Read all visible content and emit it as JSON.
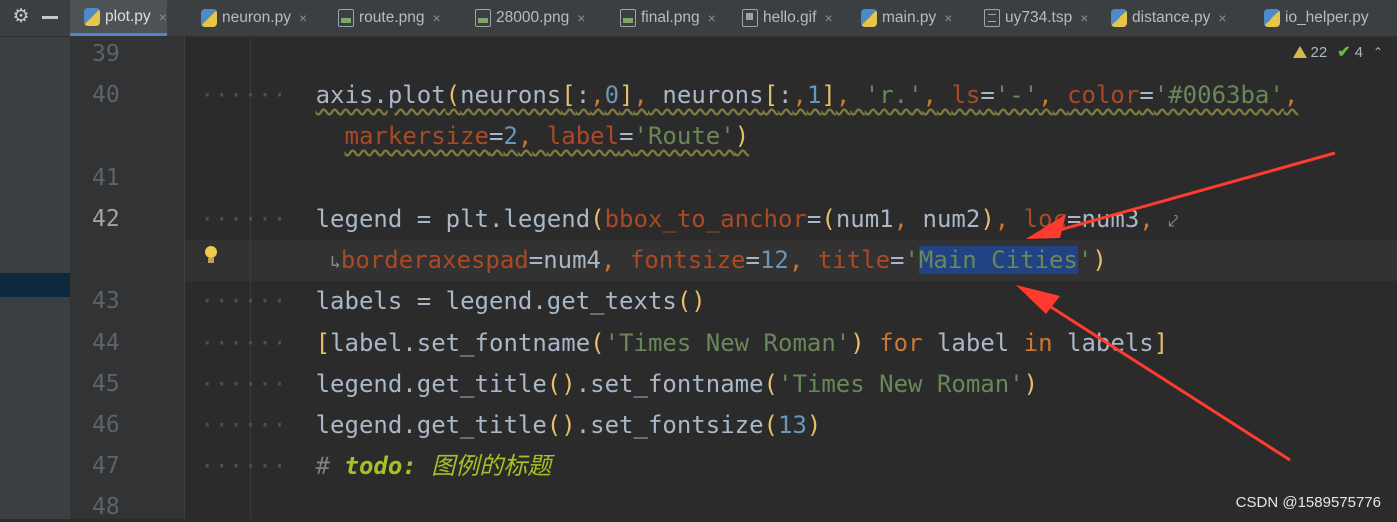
{
  "tabs": [
    {
      "label": "plot.py",
      "icon": "python-file-icon",
      "active": true
    },
    {
      "label": "neuron.py",
      "icon": "python-file-icon"
    },
    {
      "label": "route.png",
      "icon": "image-file-icon"
    },
    {
      "label": "28000.png",
      "icon": "image-file-icon"
    },
    {
      "label": "final.png",
      "icon": "image-file-icon"
    },
    {
      "label": "hello.gif",
      "icon": "gif-file-icon"
    },
    {
      "label": "main.py",
      "icon": "python-file-icon"
    },
    {
      "label": "uy734.tsp",
      "icon": "text-file-icon"
    },
    {
      "label": "distance.py",
      "icon": "python-file-icon"
    },
    {
      "label": "io_helper.py",
      "icon": "python-file-icon"
    }
  ],
  "close_glyph": "×",
  "inspection": {
    "warnings": "22",
    "checks": "4"
  },
  "line_numbers": [
    "39",
    "40",
    "41",
    "42",
    "43",
    "44",
    "45",
    "46",
    "47",
    "48"
  ],
  "code": {
    "l40a": "axis.plot(neurons[:,0], neurons[:,1], 'r.', ls='-', color='#0063ba',",
    "l40b": "markersize=2, label='Route')",
    "l42a": "legend = plt.legend(bbox_to_anchor=(num1, num2), loc=num3,",
    "l42b": "borderaxespad=num4, fontsize=12, title='Main Cities')",
    "l43": "labels = legend.get_texts()",
    "l44": "[label.set_fontname('Times New Roman') for label in labels]",
    "l45": "legend.get_title().set_fontname('Times New Roman')",
    "l46": "legend.get_title().set_fontsize(13)",
    "l47": "# todo: 图例的标题"
  },
  "selected_text": "Main Cities",
  "watermark": "CSDN @1589575776",
  "colors": {
    "annotation_arrow": "#ff3b30",
    "selection": "#214283",
    "background": "#2b2b2b"
  }
}
